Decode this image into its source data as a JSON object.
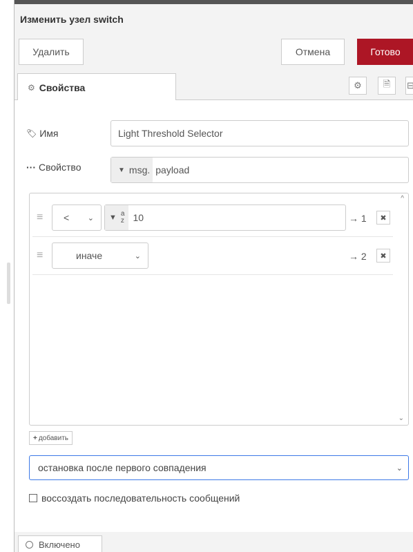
{
  "dialog": {
    "title": "Изменить узел switch",
    "delete_label": "Удалить",
    "cancel_label": "Отмена",
    "done_label": "Готово"
  },
  "tabs": {
    "properties_label": "Свойства",
    "icons": [
      "gear-icon",
      "description-icon",
      "appearance-icon"
    ]
  },
  "form": {
    "name_label": "Имя",
    "name_value": "Light Threshold Selector",
    "property_label": "Свойство",
    "property_prefix": "msg.",
    "property_value": "payload"
  },
  "rules": [
    {
      "operator": "<",
      "type_glyph_top": "a",
      "type_glyph_bottom": "z",
      "value": "10",
      "output": "→ 1"
    },
    {
      "operator": "иначе",
      "output": "→ 2"
    }
  ],
  "add_label": "добавить",
  "mode_value": "остановка после первого совпадения",
  "checkbox_label": "воссоздать последовательность сообщений",
  "status_label": "Включено",
  "colors": {
    "done_button": "#ad1625",
    "focus_border": "#3b78e7"
  }
}
